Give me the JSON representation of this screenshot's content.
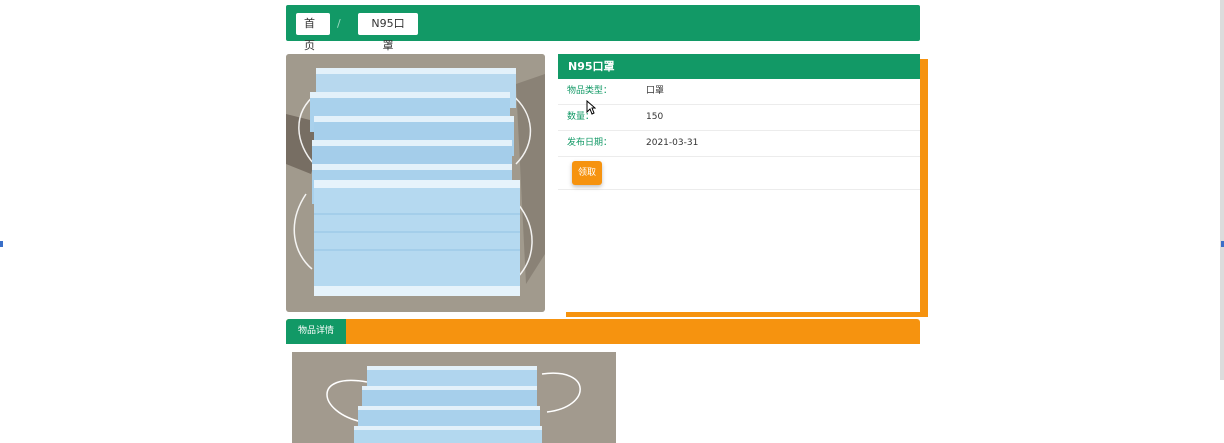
{
  "breadcrumb": {
    "home_label": "首页",
    "separator": "/",
    "current_label": "N95口罩"
  },
  "product": {
    "title": "N95口罩",
    "fields": [
      {
        "label": "物品类型：",
        "value": "口罩"
      },
      {
        "label": "数量：",
        "value": "150"
      },
      {
        "label": "发布日期：",
        "value": "2021-03-31"
      }
    ],
    "claim_button_label": "领取"
  },
  "tabs": {
    "active_label": "物品详情"
  },
  "colors": {
    "brand_green": "#129966",
    "accent_orange": "#f6930f"
  }
}
